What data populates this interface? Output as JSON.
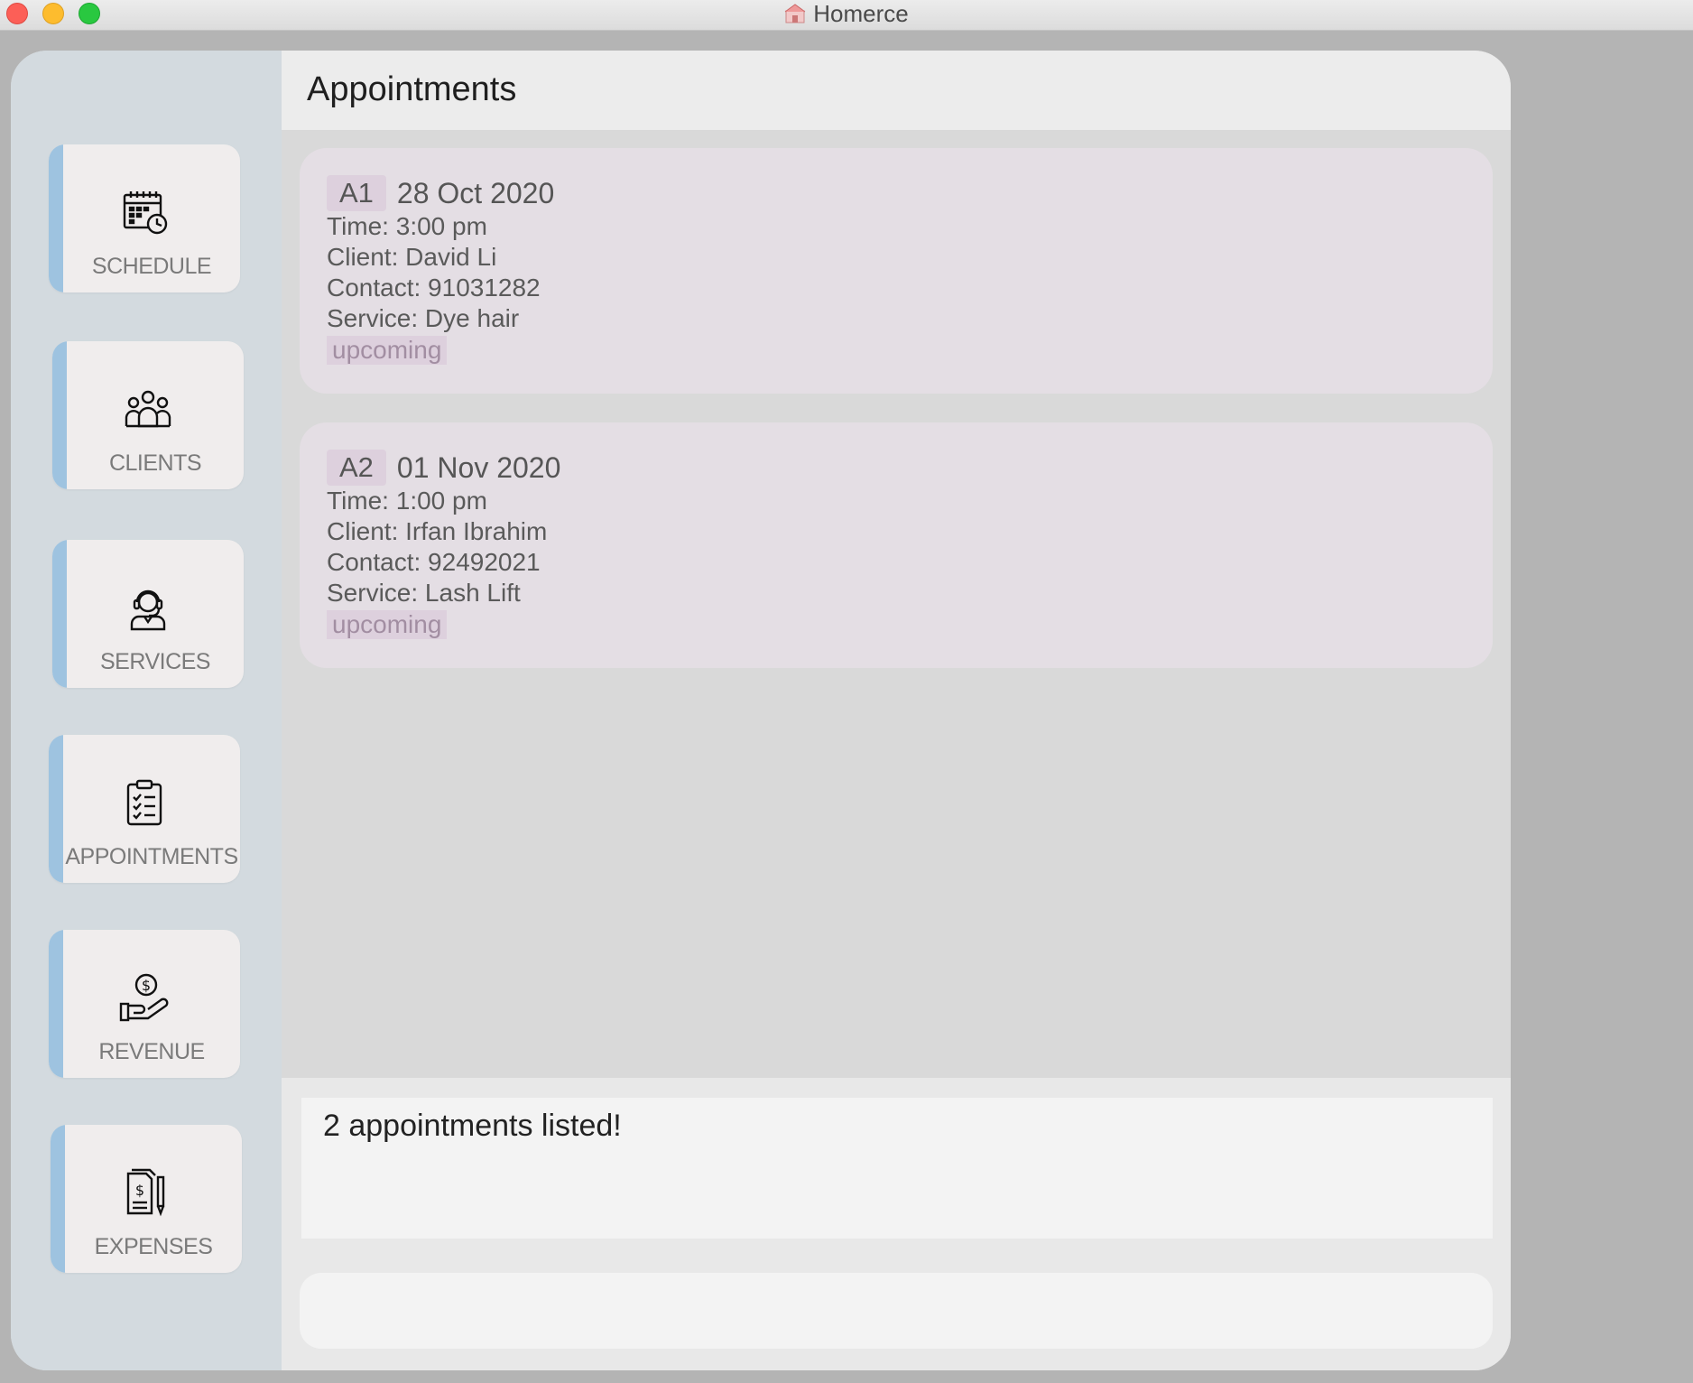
{
  "window": {
    "title": "Homerce"
  },
  "header": {
    "title": "Appointments"
  },
  "sidebar": {
    "items": [
      {
        "label": "SCHEDULE",
        "icon": "calendar-clock-icon"
      },
      {
        "label": "CLIENTS",
        "icon": "group-icon"
      },
      {
        "label": "SERVICES",
        "icon": "headset-agent-icon"
      },
      {
        "label": "APPOINTMENTS",
        "icon": "clipboard-checklist-icon"
      },
      {
        "label": "REVENUE",
        "icon": "hand-coin-icon"
      },
      {
        "label": "EXPENSES",
        "icon": "receipt-pen-icon"
      }
    ]
  },
  "appointments": [
    {
      "id": "A1",
      "date": "28 Oct 2020",
      "time": "Time: 3:00 pm",
      "client": "Client: David Li",
      "contact": "Contact: 91031282",
      "service": "Service: Dye hair",
      "status": "upcoming"
    },
    {
      "id": "A2",
      "date": "01 Nov 2020",
      "time": "Time: 1:00 pm",
      "client": "Client: Irfan Ibrahim",
      "contact": "Contact: 92492021",
      "service": "Service: Lash Lift",
      "status": "upcoming"
    }
  ],
  "result": {
    "message": "2 appointments listed!"
  },
  "command": {
    "value": "",
    "placeholder": ""
  },
  "colors": {
    "nav_accent": "#9ec3e0",
    "sidebar_bg": "#d3dadf",
    "card_bg": "#e4dee4",
    "badge_bg": "#ddd0dd"
  }
}
